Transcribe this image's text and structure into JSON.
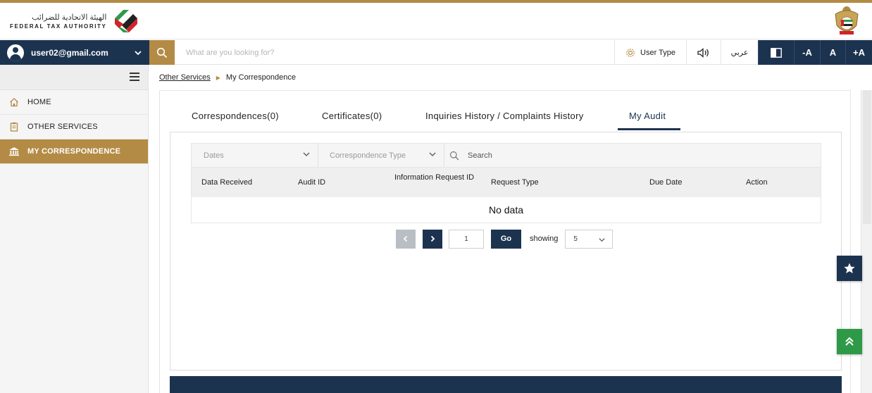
{
  "header": {
    "logo_ar": "الهيئة الاتحادية للضرائب",
    "logo_en": "FEDERAL TAX AUTHORITY"
  },
  "toolbar": {
    "user_email": "user02@gmail.com",
    "search_placeholder": "What are you looking for?",
    "user_type_label": "User Type",
    "language_label": "عربي",
    "font_decrease": "-A",
    "font_normal": "A",
    "font_increase": "+A"
  },
  "sidebar": {
    "items": [
      {
        "label": "HOME",
        "icon": "home-icon"
      },
      {
        "label": "OTHER SERVICES",
        "icon": "clipboard-icon"
      },
      {
        "label": "MY CORRESPONDENCE",
        "icon": "bank-icon",
        "active": true
      }
    ]
  },
  "breadcrumb": {
    "parent": "Other Services",
    "current": "My Correspondence"
  },
  "tabs": [
    {
      "label": "Correspondences(0)"
    },
    {
      "label": "Certificates(0)"
    },
    {
      "label": "Inquiries History / Complaints History"
    },
    {
      "label": "My Audit",
      "active": true
    }
  ],
  "filters": {
    "dates": "Dates",
    "correspondence_type": "Correspondence Type",
    "search_placeholder": "Search"
  },
  "table": {
    "columns": [
      "Data Received",
      "Audit ID",
      "Information Request ID",
      "Request Type",
      "Due Date",
      "Action"
    ],
    "empty_text": "No data"
  },
  "pagination": {
    "page": "1",
    "go_label": "Go",
    "showing_label": "showing",
    "page_size": "5"
  },
  "colors": {
    "navy": "#1c3350",
    "gold": "#b48b45",
    "green": "#2e9a48"
  }
}
